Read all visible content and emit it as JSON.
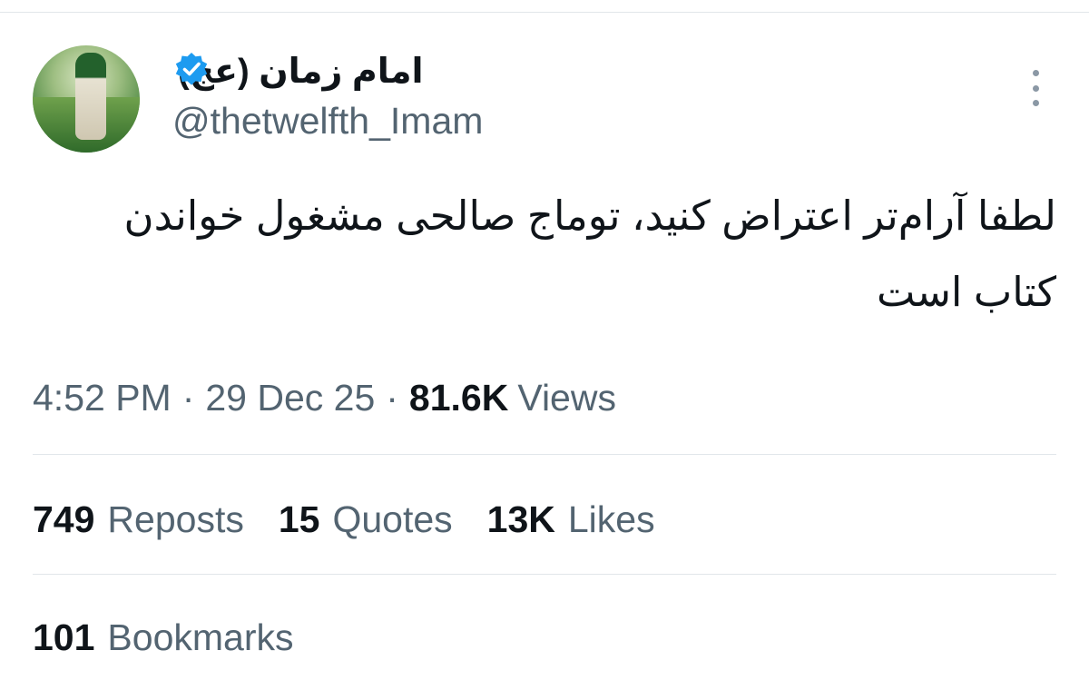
{
  "tweet": {
    "author": {
      "display_name": "امام زمان (عج)",
      "handle": "@thetwelfth_Imam",
      "verified_icon": "verified-badge-icon",
      "verified_color": "#1d9bf0"
    },
    "text_line1": "لطفا آرام‌تر اعتراض کنید، توماج صالحی مشغول خواندن",
    "text_line2": "کتاب است",
    "time": "4:52 PM",
    "separator": "·",
    "date": "29 Dec 25",
    "views_count": "81.6K",
    "views_label": "Views"
  },
  "stats": {
    "reposts": {
      "count": "749",
      "label": "Reposts"
    },
    "quotes": {
      "count": "15",
      "label": "Quotes"
    },
    "likes": {
      "count": "13K",
      "label": "Likes"
    },
    "bookmarks": {
      "count": "101",
      "label": "Bookmarks"
    }
  },
  "colors": {
    "text_primary": "#0f1419",
    "text_secondary": "#536471",
    "divider": "#e1e6ea",
    "accent": "#1d9bf0"
  }
}
